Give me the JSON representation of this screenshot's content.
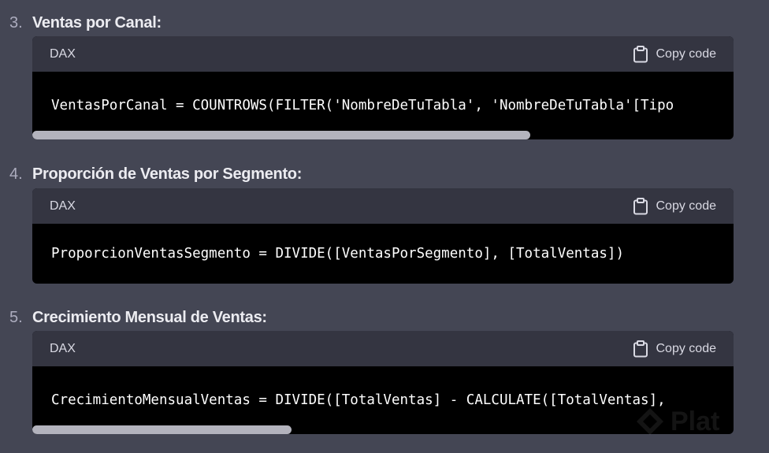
{
  "sections": [
    {
      "number": "3.",
      "title": "Ventas por Canal:",
      "language": "DAX",
      "copy_label": "Copy code",
      "code": "VentasPorCanal = COUNTROWS(FILTER('NombreDeTuTabla', 'NombreDeTuTabla'[Tipo",
      "scroll_fraction": 0.71
    },
    {
      "number": "4.",
      "title": "Proporción de Ventas por Segmento:",
      "language": "DAX",
      "copy_label": "Copy code",
      "code": "ProporcionVentasSegmento = DIVIDE([VentasPorSegmento], [TotalVentas])"
    },
    {
      "number": "5.",
      "title": "Crecimiento Mensual de Ventas:",
      "language": "DAX",
      "copy_label": "Copy code",
      "code": "CrecimientoMensualVentas = DIVIDE([TotalVentas] - CALCULATE([TotalVentas],",
      "scroll_fraction": 0.37
    }
  ],
  "watermark": "Plat",
  "colors": {
    "background": "#444654",
    "code_header": "#343541",
    "code_body": "#000000",
    "scrollbar": "#b3b3bd"
  }
}
